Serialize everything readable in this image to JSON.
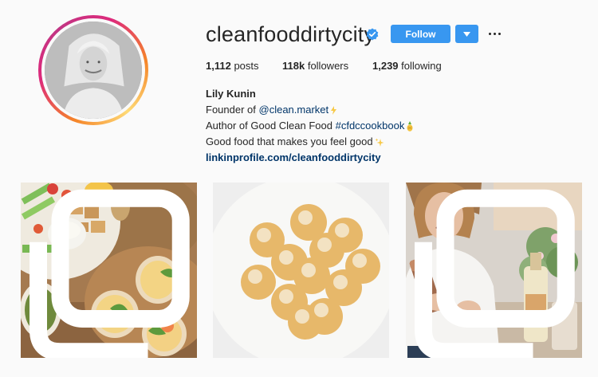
{
  "profile": {
    "username": "cleanfooddirtycity",
    "verified": true,
    "follow_label": "Follow",
    "stats": {
      "posts_count": "1,112",
      "posts_label": "posts",
      "followers_count": "118k",
      "followers_label": "followers",
      "following_count": "1,239",
      "following_label": "following"
    },
    "bio": {
      "name": "Lily Kunin",
      "line1_prefix": "Founder of ",
      "line1_link": "@clean.market",
      "line2_prefix": "Author of Good Clean Food ",
      "line2_link": "#cfdccookbook",
      "line3": "Good food that makes you feel good",
      "url": "linkinprofile.com/cleanfooddirtycity"
    }
  },
  "posts": [
    {
      "subject": "snack board with iced drinks",
      "multi": true
    },
    {
      "subject": "coconut energy balls",
      "multi": false
    },
    {
      "subject": "woman with cocktail shaker",
      "multi": true
    }
  ],
  "colors": {
    "accent": "#3897f0",
    "link": "#003569",
    "text": "#262626",
    "background": "#fafafa"
  }
}
